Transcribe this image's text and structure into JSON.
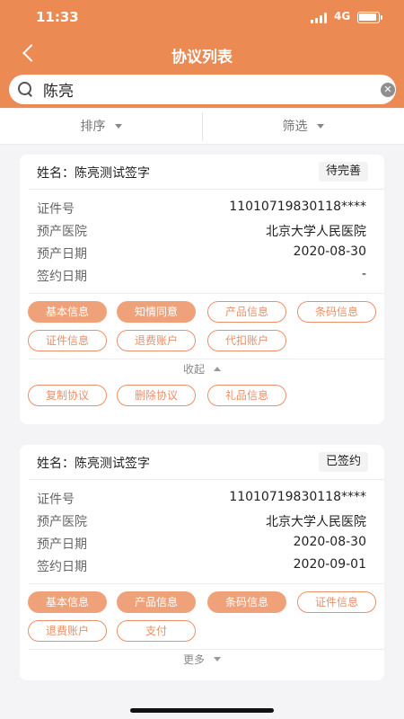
{
  "status_bar": {
    "time": "11:33",
    "network": "4G"
  },
  "nav": {
    "title": "协议列表"
  },
  "search": {
    "value": "陈亮"
  },
  "filters": {
    "sort_label": "排序",
    "filter_label": "筛选"
  },
  "cards": [
    {
      "name": "姓名：陈亮测试签字",
      "status": "待完善",
      "rows": [
        {
          "label": "证件号",
          "value": "11010719830118****"
        },
        {
          "label": "预产医院",
          "value": "北京大学人民医院"
        },
        {
          "label": "预产日期",
          "value": "2020-08-30"
        },
        {
          "label": "签约日期",
          "value": "-"
        }
      ],
      "tags_row1": [
        "基本信息",
        "知情同意",
        "产品信息",
        "条码信息"
      ],
      "tags_row2": [
        "证件信息",
        "退费账户",
        "代扣账户"
      ],
      "toggle": "收起",
      "actions": [
        "复制协议",
        "删除协议",
        "礼品信息"
      ]
    },
    {
      "name": "姓名：陈亮测试签字",
      "status": "已签约",
      "rows": [
        {
          "label": "证件号",
          "value": "11010719830118****"
        },
        {
          "label": "预产医院",
          "value": "北京大学人民医院"
        },
        {
          "label": "预产日期",
          "value": "2020-08-30"
        },
        {
          "label": "签约日期",
          "value": "2020-09-01"
        }
      ],
      "tags_row1": [
        "基本信息",
        "产品信息",
        "条码信息",
        "证件信息"
      ],
      "tags_row2": [
        "退费账户",
        "支付"
      ],
      "toggle": "更多"
    }
  ],
  "colors": {
    "brand": "#ec8a54",
    "tag_fill": "#efa27a",
    "tag_outline": "#e9906a"
  }
}
